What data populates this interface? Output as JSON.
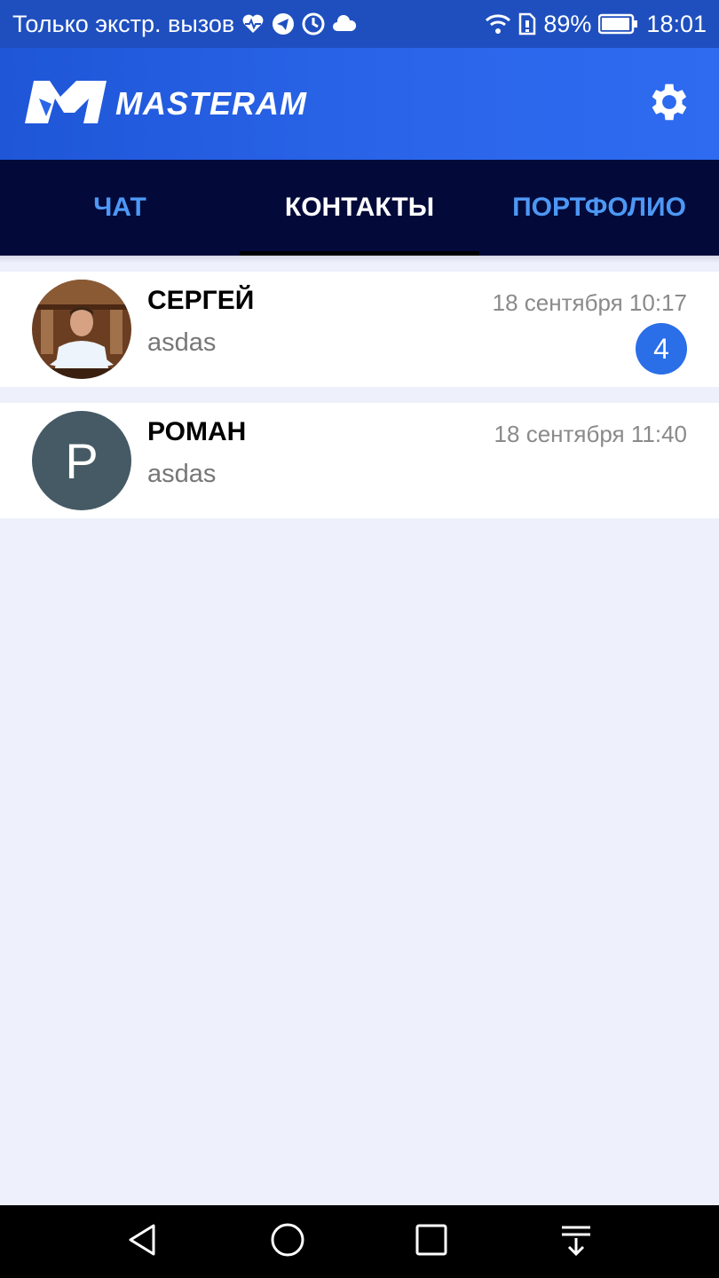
{
  "status_bar": {
    "carrier_text": "Только экстр. вызов",
    "battery": "89%",
    "time": "18:01",
    "left_icons": [
      "heart-pulse-icon",
      "telegram-icon",
      "clock-icon",
      "cloud-icon"
    ],
    "right_icons": [
      "wifi-icon",
      "sim-icon",
      "battery-icon"
    ]
  },
  "app_bar": {
    "logo_text": "MASTERAM",
    "settings_icon": "gear-icon",
    "color": "#2b66ea"
  },
  "tabs": [
    {
      "label": "ЧАТ",
      "active": false
    },
    {
      "label": "КОНТАКТЫ",
      "active": true
    },
    {
      "label": "ПОРТФОЛИО",
      "active": false
    }
  ],
  "contacts": [
    {
      "name": "СЕРГЕЙ",
      "message": "asdas",
      "time": "18 сентября 10:17",
      "unread": "4",
      "avatar": "photo"
    },
    {
      "name": "РОМАН",
      "message": "asdas",
      "time": "18 сентября 11:40",
      "avatar_letter": "P"
    }
  ],
  "nav_bar": {
    "buttons": [
      "back-icon",
      "home-icon",
      "recents-icon",
      "notification-shade-icon"
    ]
  },
  "colors": {
    "tab_bg": "#030a3a",
    "tab_inactive": "#4d98f5",
    "badge": "#2a6ee8",
    "list_bg": "#eef0fb"
  }
}
